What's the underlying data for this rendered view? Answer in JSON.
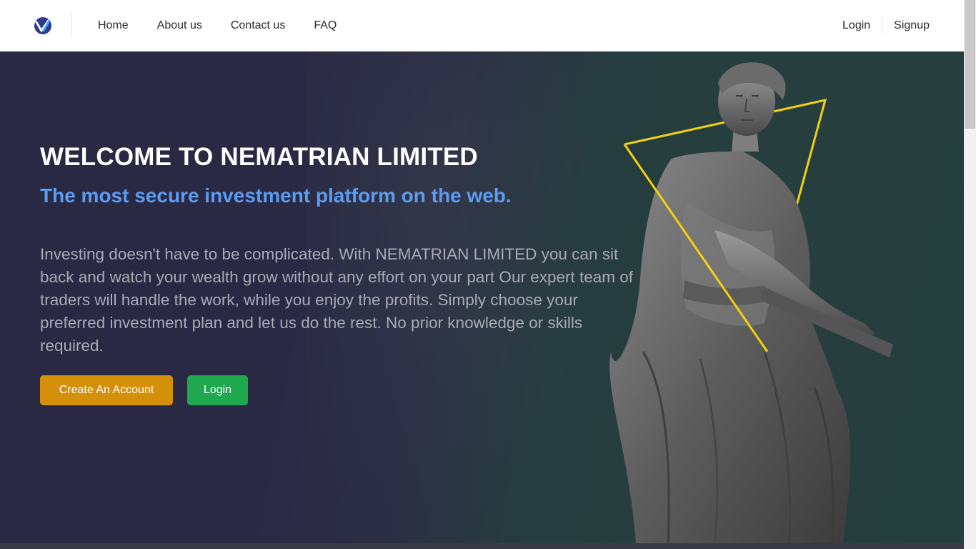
{
  "nav": {
    "links": [
      "Home",
      "About us",
      "Contact us",
      "FAQ"
    ],
    "login": "Login",
    "signup": "Signup"
  },
  "hero": {
    "title": "WELCOME TO NEMATRIAN LIMITED",
    "subtitle": "The most secure investment platform on the web.",
    "description": "Investing doesn't have to be complicated. With NEMATRIAN LIMITED you can sit back and watch your wealth grow without any effort on your part Our expert team of traders will handle the work, while you enjoy the profits. Simply choose your preferred investment plan and let us do the rest. No prior knowledge or skills required.",
    "create_button": "Create An Account",
    "login_button": "Login"
  },
  "colors": {
    "accent_blue": "#5b9cf2",
    "create_orange": "#d4900a",
    "login_green": "#1fa84e",
    "triangle_yellow": "#f2d20f"
  }
}
